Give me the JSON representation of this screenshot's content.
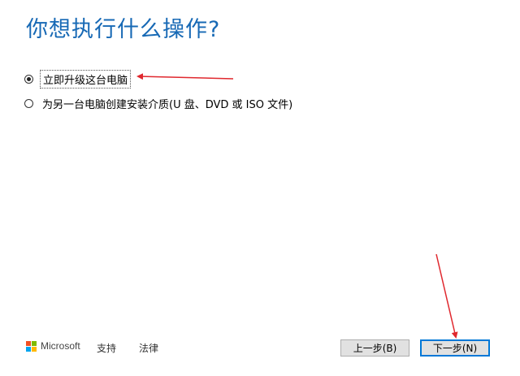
{
  "heading": "你想执行什么操作?",
  "options": [
    {
      "label": "立即升级这台电脑",
      "selected": true
    },
    {
      "label": "为另一台电脑创建安装介质(U 盘、DVD 或 ISO 文件)",
      "selected": false
    }
  ],
  "footer": {
    "brand": "Microsoft",
    "links": [
      "支持",
      "法律"
    ]
  },
  "buttons": {
    "back": "上一步(B)",
    "next": "下一步(N)"
  },
  "colors": {
    "accent": "#1769b5",
    "annotation_arrow": "#e0282e",
    "ms_logo": [
      "#f25022",
      "#7fba00",
      "#00a4ef",
      "#ffb900"
    ]
  }
}
